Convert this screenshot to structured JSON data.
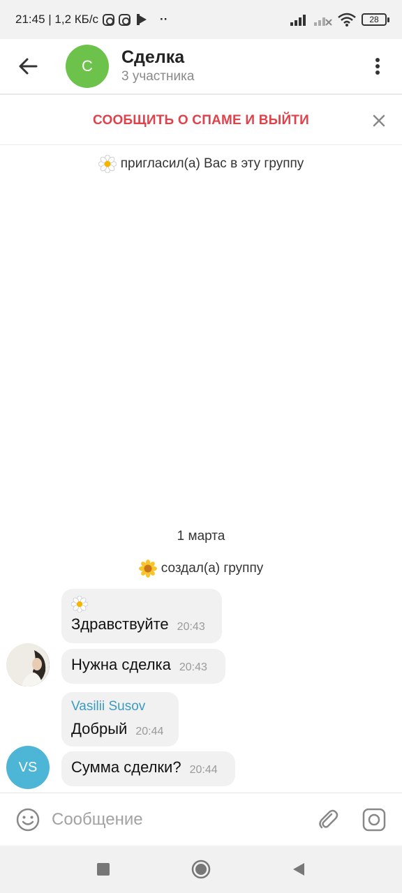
{
  "status_bar": {
    "time_speed": "21:45 | 1,2 КБ/с",
    "battery": "28",
    "dots": "··"
  },
  "header": {
    "avatar_letter": "С",
    "title": "Сделка",
    "subtitle": "3 участника"
  },
  "spam_bar": {
    "label": "СООБЩИТЬ О СПАМЕ И ВЫЙТИ"
  },
  "chat": {
    "invite_text": "пригласил(а) Вас в эту группу",
    "date_label": "1 марта",
    "created_text": "создал(а) группу",
    "messages": [
      {
        "text": "Здравствуйте",
        "time": "20:43"
      },
      {
        "text": "Нужна сделка",
        "time": "20:43"
      },
      {
        "sender": "Vasilii Susov",
        "text": "Добрый",
        "time": "20:44"
      },
      {
        "text": "Сумма сделки?",
        "time": "20:44"
      }
    ],
    "vs_initials": "VS"
  },
  "input": {
    "placeholder": "Сообщение"
  },
  "colors": {
    "group_avatar": "#6cc24a",
    "spam_red": "#e0424b",
    "sender_blue": "#3a9bbf",
    "vs_avatar": "#4db5d6"
  }
}
